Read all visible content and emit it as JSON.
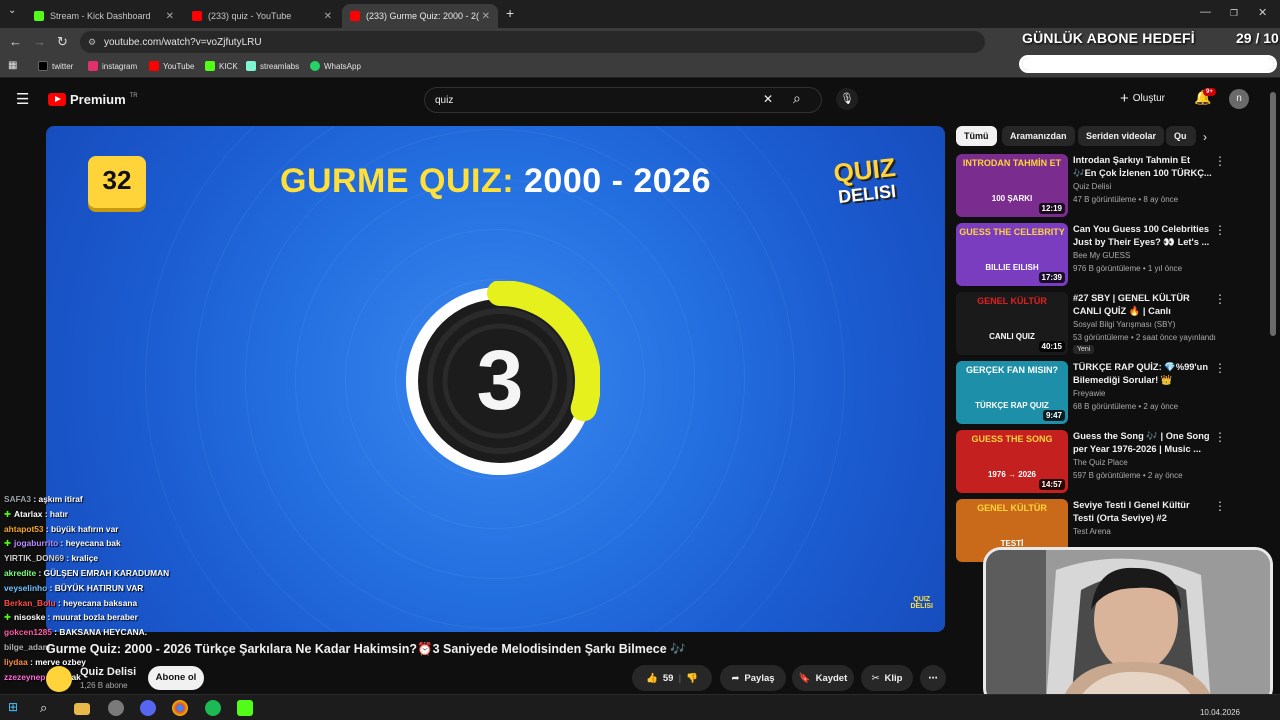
{
  "browser": {
    "tabs": [
      {
        "title": "Stream - Kick Dashboard",
        "color": "#53fc18"
      },
      {
        "title": "(233) quiz - YouTube",
        "color": "#ff0000"
      },
      {
        "title": "(233) Gurme Quiz: 2000 - 2(",
        "color": "#ff0000"
      }
    ],
    "url": "youtube.com/watch?v=voZjfutyLRU",
    "bookmarks": [
      {
        "label": "twitter",
        "color": "#000000"
      },
      {
        "label": "instagram",
        "color": "#e1306c"
      },
      {
        "label": "YouTube",
        "color": "#ff0000"
      },
      {
        "label": "KICK",
        "color": "#53fc18"
      },
      {
        "label": "streamlabs",
        "color": "#80f5d2"
      },
      {
        "label": "WhatsApp",
        "color": "#25d366"
      }
    ]
  },
  "youtube": {
    "logo": "Premium",
    "logo_region": "TR",
    "search_query": "quiz",
    "create_label": "Oluştur",
    "notif_count": "9+",
    "avatar_letter": "n"
  },
  "video": {
    "counter": "32",
    "title_part1": "GURME QUIZ:",
    "title_part2": "2000 - 2026",
    "logo_line1": "QUIZ",
    "logo_line2": "DELISI",
    "countdown": "3",
    "countdown_progress": 0.3,
    "watermark_line1": "QUIZ",
    "watermark_line2": "DELISI",
    "full_title": "Gurme Quiz: 2000 - 2026 Türkçe Şarkılara Ne Kadar Hakimsin?⏰3 Saniyede Melodisinden Şarkı Bilmece 🎶",
    "channel": "Quiz Delisi",
    "subs": "1,26 B abone",
    "subscribe": "Abone ol",
    "likes": "59",
    "share": "Paylaş",
    "save": "Kaydet",
    "clip": "Klip"
  },
  "chat": [
    {
      "user": "SAFA3",
      "msg": "aşkım itiraf",
      "color": "#9aa5a9",
      "icon": false
    },
    {
      "user": "Atarlax",
      "msg": "hatır",
      "color": "#ffffff",
      "icon": true
    },
    {
      "user": "ahtapot53",
      "msg": "büyük hafırın var",
      "color": "#f5a623",
      "icon": false
    },
    {
      "user": "jogaburrito",
      "msg": "heyecana bak",
      "color": "#b48cff",
      "icon": true
    },
    {
      "user": "YIRTIK_DON69",
      "msg": "kraliçe",
      "color": "#cfcfcf",
      "icon": false
    },
    {
      "user": "akredite",
      "msg": "GÜLŞEN EMRAH KARADUMAN",
      "color": "#7cff7c",
      "icon": false
    },
    {
      "user": "veyselinho",
      "msg": "BÜYÜK HATIRUN VAR",
      "color": "#6fc2ff",
      "icon": false
    },
    {
      "user": "Berkan_Bolu",
      "msg": "heyecana baksana",
      "color": "#ff4a4a",
      "icon": false
    },
    {
      "user": "nisoske",
      "msg": "muurat bozla beraber",
      "color": "#ffffff",
      "icon": true
    },
    {
      "user": "gokcen1285",
      "msg": "BAKSANA HEYCANA.",
      "color": "#ff5aa5",
      "icon": false
    },
    {
      "user": "bilge_adam",
      "msg": "",
      "color": "#b0b0b0",
      "icon": false
    },
    {
      "user": "liydaa",
      "msg": "merve ozbey",
      "color": "#ff8c42",
      "icon": false
    },
    {
      "user": "zzezeynep",
      "msg": "cakcak",
      "color": "#ff6ad5",
      "icon": false
    }
  ],
  "sidebar": {
    "chips": [
      "Tümü",
      "Aramanızdan",
      "Seriden videolar",
      "Qu"
    ],
    "recs": [
      {
        "title": "Introdan Şarkıyı Tahmin Et 🎶En Çok İzlenen 100 TÜRKÇ...",
        "channel": "Quiz Delisi",
        "views": "47 B görüntüleme",
        "age": "8 ay önce",
        "duration": "12:19",
        "thumb_text": "INTRODAN TAHMİN ET",
        "thumb_sub": "100 ŞARKI",
        "bg": "#7a2d8f",
        "accent": "#ffd43a",
        "is_new": false,
        "new_label": ""
      },
      {
        "title": "Can You Guess 100 Celebrities Just by Their Eyes? 👀 Let's ...",
        "channel": "Bee My GUESS",
        "views": "976 B görüntüleme",
        "age": "1 yıl önce",
        "duration": "17:39",
        "thumb_text": "GUESS THE CELEBRITY",
        "thumb_sub": "BILLIE EILISH",
        "bg": "#7b3dbf",
        "accent": "#ffd43a",
        "is_new": false,
        "new_label": ""
      },
      {
        "title": "#27 SBY | GENEL KÜLTÜR CANLI QUİZ 🔥 | Canlı",
        "channel": "Sosyal Bilgi Yarışması (SBY)",
        "views": "53 görüntüleme",
        "age": "2 saat önce yayınlandı",
        "duration": "40:15",
        "thumb_text": "GENEL KÜLTÜR",
        "thumb_sub": "CANLI QUIZ",
        "bg": "#1a1a1a",
        "accent": "#e02020",
        "is_new": true,
        "new_label": "Yeni"
      },
      {
        "title": "TÜRKÇE RAP QUİZ: 💎%99'un Bilemediği Sorular! 👑",
        "channel": "Freyawie",
        "views": "68 B görüntüleme",
        "age": "2 ay önce",
        "duration": "9:47",
        "thumb_text": "GERÇEK FAN MISIN?",
        "thumb_sub": "TÜRKÇE RAP QUIZ",
        "bg": "#1d8fa8",
        "accent": "#ffffff",
        "is_new": false,
        "new_label": ""
      },
      {
        "title": "Guess the Song 🎶 | One Song per Year 1976-2026 | Music ...",
        "channel": "The Quiz Place",
        "views": "597 B görüntüleme",
        "age": "2 ay önce",
        "duration": "14:57",
        "thumb_text": "GUESS THE SONG",
        "thumb_sub": "1976 → 2026",
        "bg": "#c52020",
        "accent": "#ffd43a",
        "is_new": false,
        "new_label": ""
      },
      {
        "title": "Seviye Testi I Genel Kültür Testi (Orta Seviye) #2",
        "channel": "Test Arena",
        "views": "",
        "age": "",
        "duration": "",
        "thumb_text": "GENEL KÜLTÜR",
        "thumb_sub": "TESTİ",
        "bg": "#c86a1a",
        "accent": "#ffd43a",
        "is_new": false,
        "new_label": ""
      }
    ]
  },
  "overlay": {
    "goal_label": "GÜNLÜK ABONE HEDEFİ",
    "goal_count": "29 / 10",
    "goal_progress": 1.0
  },
  "taskbar": {
    "date": "10.04.2026"
  }
}
